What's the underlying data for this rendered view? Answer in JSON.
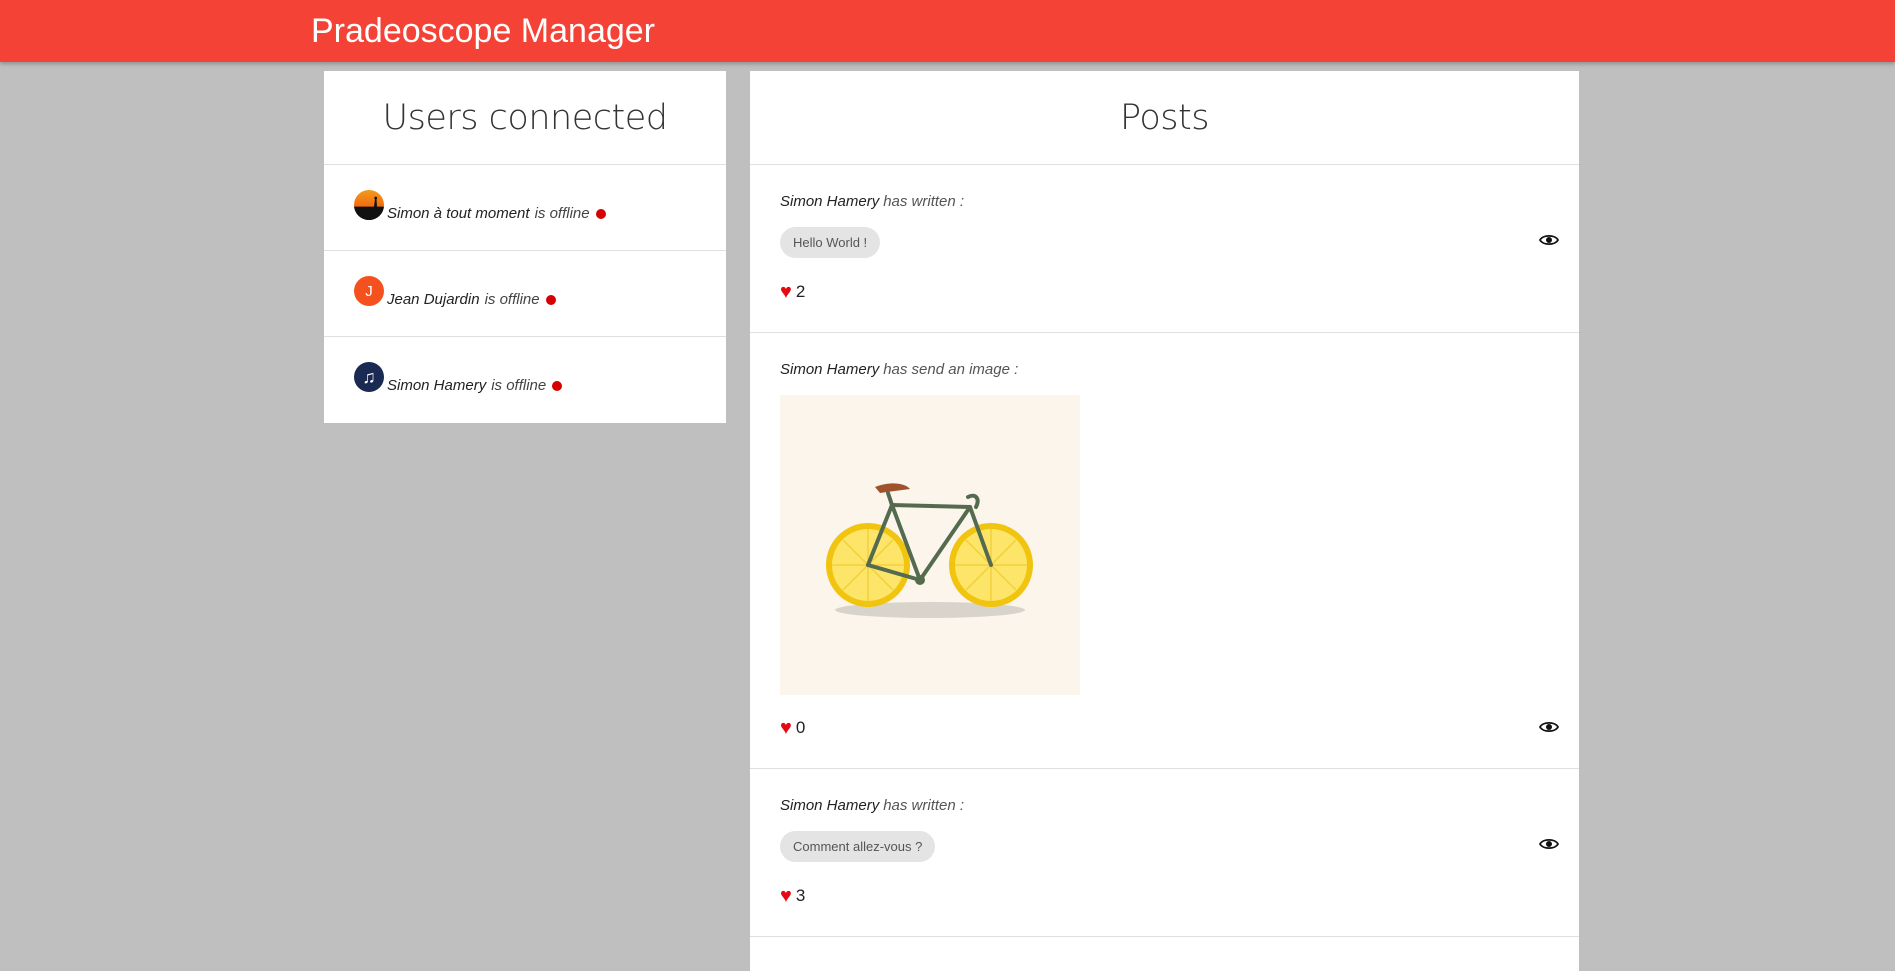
{
  "app": {
    "title": "Pradeoscope Manager",
    "accent_color": "#f44336"
  },
  "users_panel": {
    "heading": "Users connected",
    "users": [
      {
        "name": "Simon à tout moment",
        "status": "is offline",
        "avatar": "sunset-avatar"
      },
      {
        "name": "Jean Dujardin",
        "status": "is offline",
        "avatar": "initial-avatar",
        "initial": "J"
      },
      {
        "name": "Simon Hamery",
        "status": "is offline",
        "avatar": "music-note-avatar"
      }
    ]
  },
  "posts_panel": {
    "heading": "Posts",
    "posts": [
      {
        "author": "Simon Hamery",
        "action": "has written :",
        "message": "Hello World !",
        "likes": "2",
        "icon": "eye-icon"
      },
      {
        "author": "Simon Hamery",
        "action": "has send an image :",
        "image": "lemon-bicycle-image",
        "likes": "0",
        "icon": "eye-icon"
      },
      {
        "author": "Simon Hamery",
        "action": "has written :",
        "message": "Comment allez-vous ?",
        "likes": "3",
        "icon": "eye-icon"
      }
    ]
  }
}
